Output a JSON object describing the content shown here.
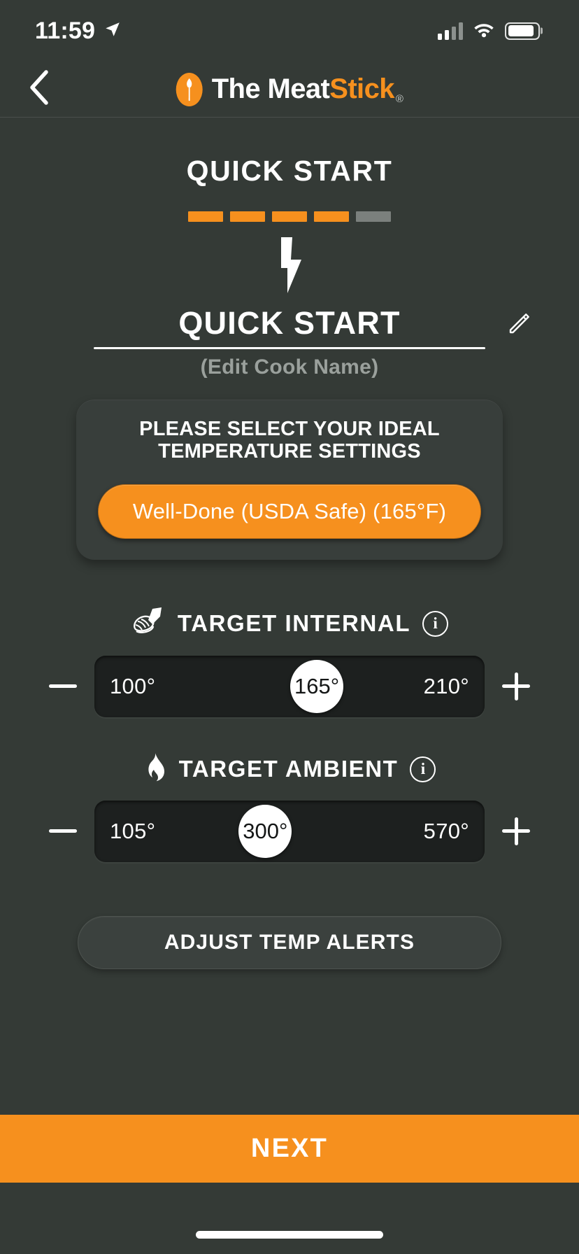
{
  "status_bar": {
    "time": "11:59",
    "location_icon": "location-arrow-icon",
    "signal_icon": "cellular-signal-icon",
    "wifi_icon": "wifi-icon",
    "battery_icon": "battery-icon"
  },
  "navbar": {
    "back_icon": "chevron-left-icon",
    "brand_prefix": "The Meat",
    "brand_accent": "Stick",
    "brand_registered": "®",
    "brand_mark_icon": "meat-probe-logo-icon"
  },
  "page": {
    "title": "QUICK START",
    "progress": {
      "total": 5,
      "completed": 4,
      "active_color": "#f6901e",
      "inactive_color": "#7b807d"
    },
    "mode_icon": "lightning-bolt-icon",
    "cook_name": "QUICK START",
    "cook_name_hint": "(Edit Cook Name)",
    "edit_icon": "pencil-icon"
  },
  "doneness_card": {
    "title": "PLEASE SELECT YOUR IDEAL TEMPERATURE SETTINGS",
    "selected_option": "Well-Done (USDA Safe) (165°F)"
  },
  "target_internal": {
    "icon": "meat-probe-icon",
    "label": "TARGET INTERNAL",
    "info_icon": "info-icon",
    "info_char": "i",
    "decrement_icon": "minus-icon",
    "increment_icon": "plus-icon",
    "min_label": "100°",
    "max_label": "210°",
    "value_label": "165°",
    "min": 100,
    "max": 210,
    "value": 165
  },
  "target_ambient": {
    "icon": "flame-icon",
    "label": "TARGET AMBIENT",
    "info_icon": "info-icon",
    "info_char": "i",
    "decrement_icon": "minus-icon",
    "increment_icon": "plus-icon",
    "min_label": "105°",
    "max_label": "570°",
    "value_label": "300°",
    "min": 105,
    "max": 570,
    "value": 300
  },
  "alerts_button": {
    "label": "ADJUST TEMP ALERTS"
  },
  "footer": {
    "next_label": "NEXT"
  },
  "colors": {
    "background": "#343a36",
    "accent_orange": "#f6901e",
    "card": "#383e3b",
    "slider_track": "#1d201f",
    "muted_text": "#9aa09c"
  }
}
